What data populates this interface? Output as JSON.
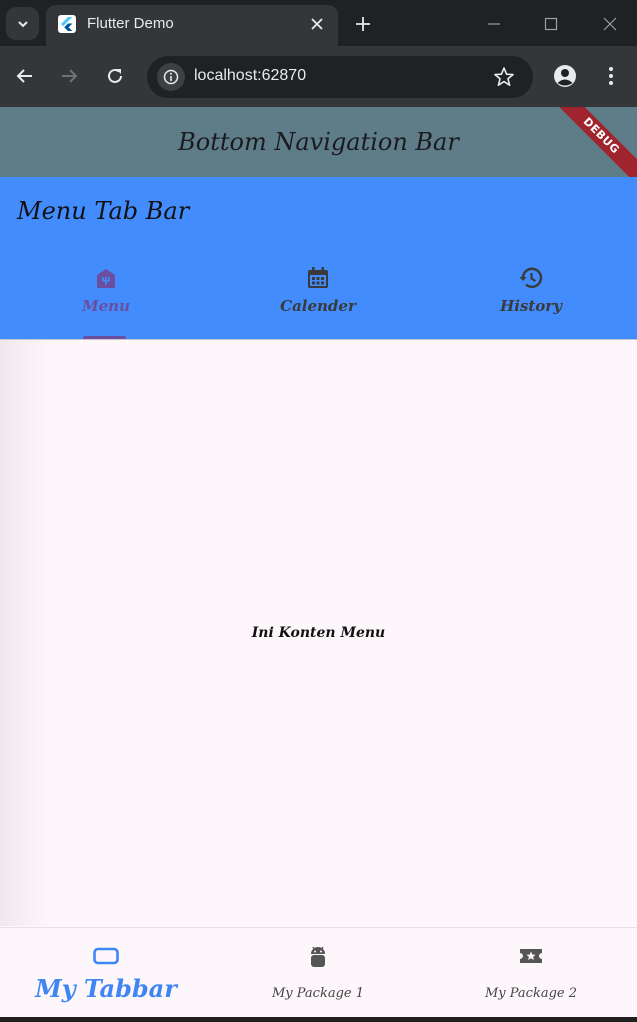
{
  "browser": {
    "tab_title": "Flutter Demo",
    "url": "localhost:62870",
    "icons": [
      "tab-search-icon",
      "flutter-logo-icon",
      "close-icon",
      "plus-icon",
      "minimize-icon",
      "maximize-icon",
      "window-close-icon",
      "back-icon",
      "forward-icon",
      "reload-icon",
      "info-icon",
      "star-icon",
      "profile-icon",
      "more-vert-icon"
    ]
  },
  "app": {
    "appbar_title": "Bottom Navigation Bar",
    "debug_banner": "DEBUG",
    "tabbar_title": "Menu Tab Bar",
    "tabs": [
      {
        "label": "Menu",
        "icon": "storefront-icon",
        "active": true
      },
      {
        "label": "Calender",
        "icon": "calendar-icon",
        "active": false
      },
      {
        "label": "History",
        "icon": "history-icon",
        "active": false
      }
    ],
    "content_text": "Ini Konten Menu",
    "bottom_nav": [
      {
        "label": "My Tabbar",
        "icon": "tablet-icon",
        "active": true
      },
      {
        "label": "My Package 1",
        "icon": "android-icon",
        "active": false
      },
      {
        "label": "My Package 2",
        "icon": "local-activity-icon",
        "active": false
      }
    ]
  },
  "colors": {
    "appbar": "#5f7d88",
    "tabbar": "#428cfd",
    "active_tab": "#6a4fa0",
    "active_bottom": "#3f86f2",
    "background": "#fdf7fc"
  }
}
